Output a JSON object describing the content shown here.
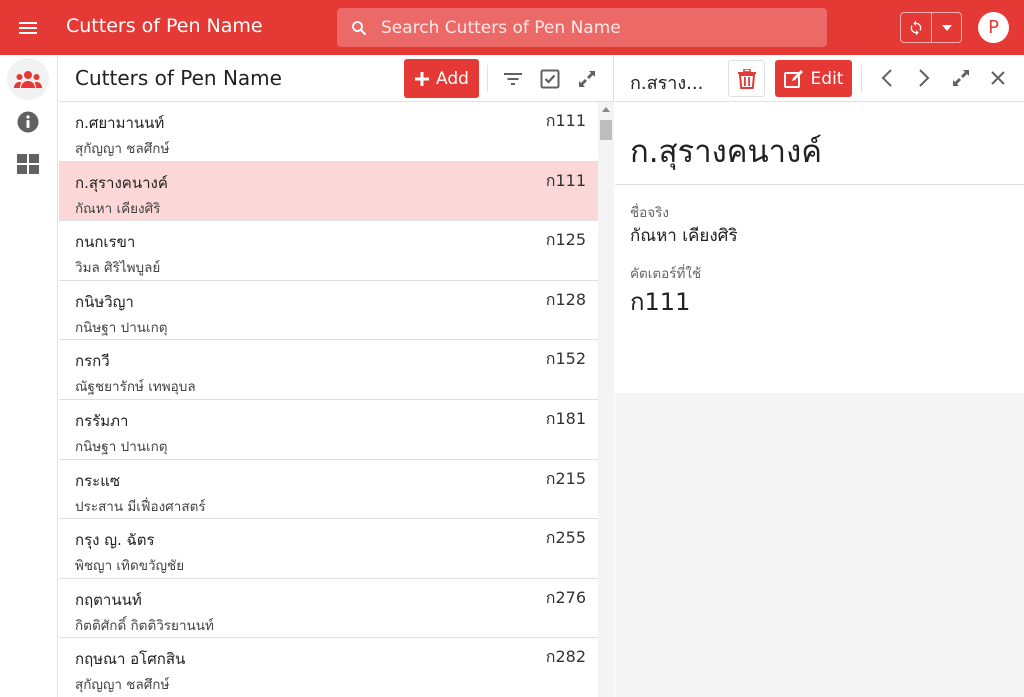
{
  "colors": {
    "primary": "#e53935",
    "selected_row": "#fbd7d7",
    "detail_bg": "#f5f5f5"
  },
  "topbar": {
    "menu_icon": "hamburger-icon",
    "title": "Cutters of Pen Name",
    "search_placeholder": "Search Cutters of Pen Name",
    "search_icon": "search-icon",
    "sync_icon": "sync-icon",
    "dropdown_icon": "caret-down-icon",
    "avatar_letter": "P"
  },
  "rail": [
    {
      "icon": "people-icon",
      "active": true
    },
    {
      "icon": "info-icon",
      "active": false
    },
    {
      "icon": "dashboard-icon",
      "active": false
    }
  ],
  "list": {
    "title": "Cutters of Pen Name",
    "add_label": "Add",
    "rows": [
      {
        "name": "ก.ศยามานนท์",
        "sub": "สุกัญญา ชลศึกษ์",
        "code": "ก111",
        "selected": false
      },
      {
        "name": "ก.สุรางคนางค์",
        "sub": "กัณหา เคียงศิริ",
        "code": "ก111",
        "selected": true
      },
      {
        "name": "กนกเรขา",
        "sub": "วิมล ศิริไพบูลย์",
        "code": "ก125",
        "selected": false
      },
      {
        "name": "กนิษวิญา",
        "sub": "กนิษฐา ปานเกตุ",
        "code": "ก128",
        "selected": false
      },
      {
        "name": "กรกวี",
        "sub": "ณัฐชยารักษ์ เทพอุบล",
        "code": "ก152",
        "selected": false
      },
      {
        "name": "กรรัมภา",
        "sub": "กนิษฐา ปานเกตุ",
        "code": "ก181",
        "selected": false
      },
      {
        "name": "กระแซ",
        "sub": "ประสาน มีเฟื่องศาสตร์",
        "code": "ก215",
        "selected": false
      },
      {
        "name": "กรุง ญ. ฉัตร",
        "sub": "พิชญา เทิดขวัญชัย",
        "code": "ก255",
        "selected": false
      },
      {
        "name": "กฤตานนท์",
        "sub": "กิตติศักดิ์ กิตติวิรยานนท์",
        "code": "ก276",
        "selected": false
      },
      {
        "name": "กฤษณา อโศกสิน",
        "sub": "สุกัญญา ชลศึกษ์",
        "code": "ก282",
        "selected": false
      }
    ]
  },
  "detail": {
    "header_title": "ก.สราง...",
    "edit_label": "Edit",
    "title": "ก.สุรางคนางค์",
    "fields": [
      {
        "label": "ชื่อจริง",
        "value": "กัณหา เคียงศิริ"
      },
      {
        "label": "คัตเตอร์ที่ใช้",
        "value": "ก111"
      }
    ]
  }
}
